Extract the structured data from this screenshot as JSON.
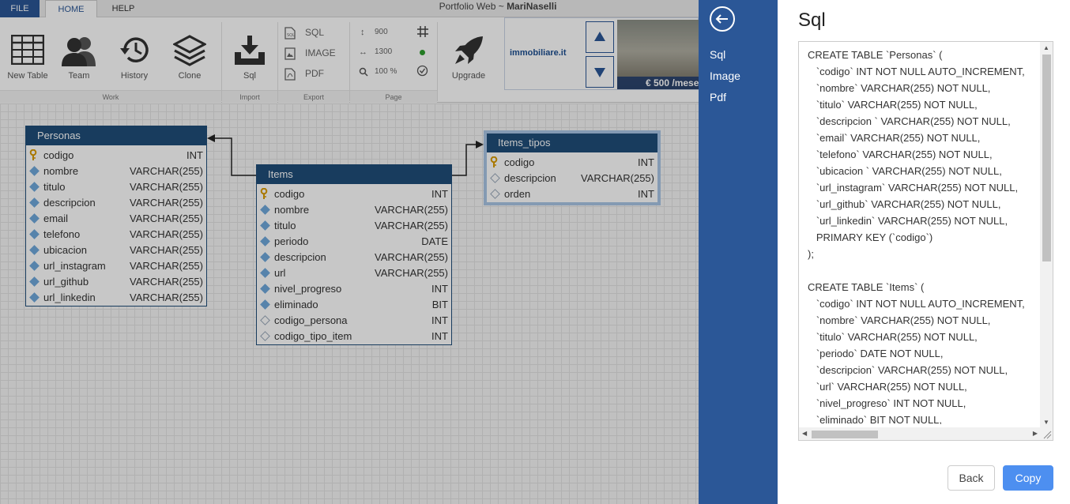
{
  "menu": {
    "file": "FILE",
    "home": "HOME",
    "help": "HELP"
  },
  "app_title_prefix": "Portfolio Web ~ ",
  "app_title_user": "MariNaselli",
  "ribbon": {
    "new_table": "New Table",
    "team": "Team",
    "history": "History",
    "clone": "Clone",
    "sql": "Sql",
    "export_sql": "SQL",
    "export_image": "IMAGE",
    "export_pdf": "PDF",
    "page_height": "900",
    "page_width": "1300",
    "zoom": "100 %",
    "upgrade": "Upgrade",
    "groups": {
      "work": "Work",
      "import": "Import",
      "export": "Export",
      "page": "Page"
    }
  },
  "ad": {
    "logo": "immobiliare.it",
    "price": "€ 500 /mese"
  },
  "entities": {
    "personas": {
      "title": "Personas",
      "rows": [
        {
          "name": "codigo",
          "type": "INT"
        },
        {
          "name": "nombre",
          "type": "VARCHAR(255)"
        },
        {
          "name": "titulo",
          "type": "VARCHAR(255)"
        },
        {
          "name": "descripcion",
          "type": "VARCHAR(255)"
        },
        {
          "name": "email",
          "type": "VARCHAR(255)"
        },
        {
          "name": "telefono",
          "type": "VARCHAR(255)"
        },
        {
          "name": "ubicacion",
          "type": "VARCHAR(255)"
        },
        {
          "name": "url_instagram",
          "type": "VARCHAR(255)"
        },
        {
          "name": "url_github",
          "type": "VARCHAR(255)"
        },
        {
          "name": "url_linkedin",
          "type": "VARCHAR(255)"
        }
      ]
    },
    "items": {
      "title": "Items",
      "rows": [
        {
          "name": "codigo",
          "type": "INT"
        },
        {
          "name": "nombre",
          "type": "VARCHAR(255)"
        },
        {
          "name": "titulo",
          "type": "VARCHAR(255)"
        },
        {
          "name": "periodo",
          "type": "DATE"
        },
        {
          "name": "descripcion",
          "type": "VARCHAR(255)"
        },
        {
          "name": "url",
          "type": "VARCHAR(255)"
        },
        {
          "name": "nivel_progreso",
          "type": "INT"
        },
        {
          "name": "eliminado",
          "type": "BIT"
        },
        {
          "name": "codigo_persona",
          "type": "INT"
        },
        {
          "name": "codigo_tipo_item",
          "type": "INT"
        }
      ]
    },
    "items_tipos": {
      "title": "Items_tipos",
      "rows": [
        {
          "name": "codigo",
          "type": "INT"
        },
        {
          "name": "descripcion",
          "type": "VARCHAR(255)"
        },
        {
          "name": "orden",
          "type": "INT"
        }
      ]
    }
  },
  "modal": {
    "nav": [
      "Sql",
      "Image",
      "Pdf"
    ],
    "title": "Sql",
    "code": "CREATE TABLE `Personas` (\n   `codigo` INT NOT NULL AUTO_INCREMENT,\n   `nombre` VARCHAR(255) NOT NULL,\n   `titulo` VARCHAR(255) NOT NULL,\n   `descripcion ` VARCHAR(255) NOT NULL,\n   `email` VARCHAR(255) NOT NULL,\n   `telefono` VARCHAR(255) NOT NULL,\n   `ubicacion ` VARCHAR(255) NOT NULL,\n   `url_instagram` VARCHAR(255) NOT NULL,\n   `url_github` VARCHAR(255) NOT NULL,\n   `url_linkedin` VARCHAR(255) NOT NULL,\n   PRIMARY KEY (`codigo`)\n);\n\nCREATE TABLE `Items` (\n   `codigo` INT NOT NULL AUTO_INCREMENT,\n   `nombre` VARCHAR(255) NOT NULL,\n   `titulo` VARCHAR(255) NOT NULL,\n   `periodo` DATE NOT NULL,\n   `descripcion` VARCHAR(255) NOT NULL,\n   `url` VARCHAR(255) NOT NULL,\n   `nivel_progreso` INT NOT NULL,\n   `eliminado` BIT NOT NULL,",
    "back_label": "Back",
    "copy_label": "Copy"
  },
  "colors": {
    "primary": "#2b5797",
    "entity_header": "#1f4e79",
    "copy_button": "#4d8ff0"
  }
}
